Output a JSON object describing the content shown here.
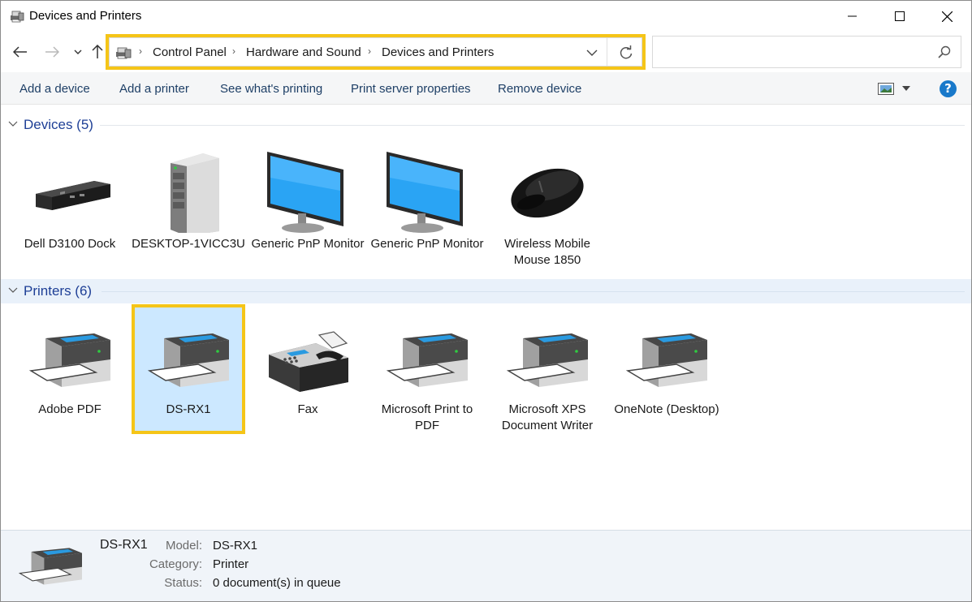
{
  "window": {
    "title": "Devices and Printers"
  },
  "nav": {
    "breadcrumbs": [
      "Control Panel",
      "Hardware and Sound",
      "Devices and Printers"
    ],
    "search_placeholder": ""
  },
  "commands": [
    "Add a device",
    "Add a printer",
    "See what's printing",
    "Print server properties",
    "Remove device"
  ],
  "help_label": "?",
  "groups": {
    "devices": {
      "title": "Devices (5)",
      "items": [
        {
          "label": "Dell D3100 Dock",
          "icon": "dock-icon"
        },
        {
          "label": "DESKTOP-1VICC3U",
          "icon": "computer-tower-icon"
        },
        {
          "label": "Generic PnP Monitor",
          "icon": "monitor-icon"
        },
        {
          "label": "Generic PnP Monitor",
          "icon": "monitor-icon"
        },
        {
          "label": "Wireless Mobile Mouse 1850",
          "icon": "mouse-icon"
        }
      ]
    },
    "printers": {
      "title": "Printers (6)",
      "items": [
        {
          "label": "Adobe PDF",
          "icon": "printer-icon"
        },
        {
          "label": "DS-RX1",
          "icon": "printer-icon",
          "selected": true
        },
        {
          "label": "Fax",
          "icon": "fax-icon"
        },
        {
          "label": "Microsoft Print to PDF",
          "icon": "printer-icon"
        },
        {
          "label": "Microsoft XPS Document Writer",
          "icon": "printer-icon"
        },
        {
          "label": "OneNote (Desktop)",
          "icon": "printer-icon"
        }
      ]
    }
  },
  "details": {
    "name": "DS-RX1",
    "model_key": "Model:",
    "model_val": "DS-RX1",
    "category_key": "Category:",
    "category_val": "Printer",
    "status_key": "Status:",
    "status_val": "0 document(s) in queue"
  },
  "colors": {
    "accent_highlight": "#f5c518",
    "selection": "#cce8ff",
    "group_title": "#1e3f96",
    "command_text": "#1e3f66",
    "help": "#1979ca"
  }
}
